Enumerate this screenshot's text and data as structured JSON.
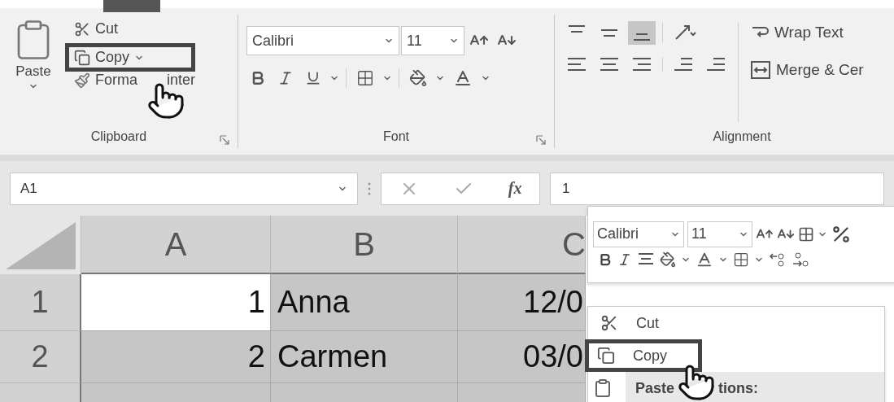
{
  "ribbon": {
    "groups": [
      {
        "kind": "clipboard",
        "label": "Clipboard",
        "paste": "Paste",
        "cut": "Cut",
        "copy": {
          "label": "Copy",
          "highlighted": true
        },
        "format_painter": {
          "label_before": "Forma",
          "label_after": "inter"
        }
      },
      {
        "kind": "font",
        "label": "Font",
        "font_name": "Calibri",
        "font_size": "11"
      },
      {
        "kind": "alignment",
        "label": "Alignment",
        "vertical": [
          {
            "selected": false
          },
          {
            "selected": false
          },
          {
            "selected": true
          }
        ],
        "wrap_text": "Wrap Text",
        "merge": "Merge & Cer"
      }
    ]
  },
  "formula_bar": {
    "name_box": "A1",
    "function_label": "fx",
    "value": "1"
  },
  "sheet": {
    "columns": [
      "A",
      "B",
      "C"
    ],
    "rows": [
      {
        "header": "1",
        "cells": [
          {
            "value": "1",
            "active": true
          },
          {
            "value": "Anna",
            "active": false
          },
          {
            "value": "12/0",
            "active": false
          }
        ]
      },
      {
        "header": "2",
        "cells": [
          {
            "value": "2",
            "active": false
          },
          {
            "value": "Carmen",
            "active": false
          },
          {
            "value": "03/0",
            "active": false
          }
        ]
      }
    ]
  },
  "mini_toolbar": {
    "font_name": "Calibri",
    "font_size": "11"
  },
  "context_menu": {
    "items": [
      {
        "kind": "command",
        "label": "Cut",
        "highlighted": false
      },
      {
        "kind": "command",
        "label": "Copy",
        "highlighted": true
      },
      {
        "kind": "section",
        "label_before": "Paste",
        "label_after": "tions:"
      }
    ]
  }
}
